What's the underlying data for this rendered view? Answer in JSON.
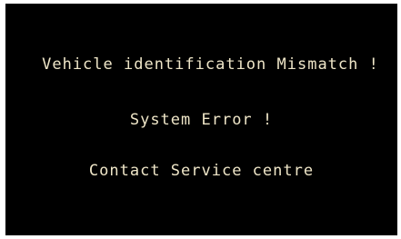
{
  "display": {
    "line1": "Vehicle identification  Mismatch !",
    "line2": "System Error !",
    "line3": "Contact Service centre",
    "text_color": "#efe6c8",
    "background_color": "#000000"
  }
}
